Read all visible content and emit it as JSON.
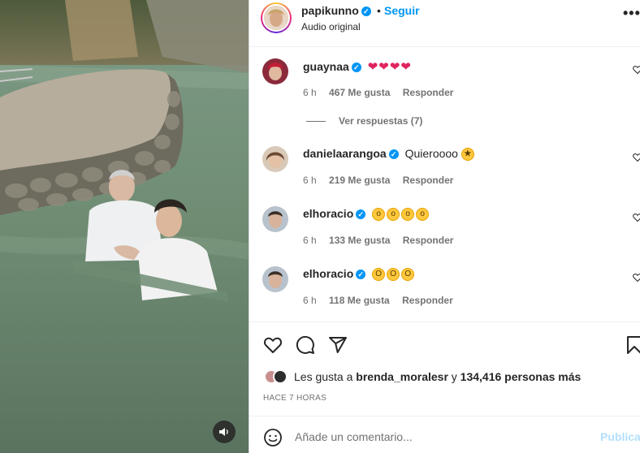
{
  "header": {
    "username": "papikunno",
    "separator": "•",
    "follow_label": "Seguir",
    "audio_label": "Audio original",
    "more_label": "•••"
  },
  "comments": [
    {
      "username": "guaynaa",
      "text": "❤❤❤❤",
      "time": "6 h",
      "likes": "467 Me gusta",
      "reply": "Responder",
      "avatar_color": "#8a2a3a"
    },
    {
      "username": "danielaarangoa",
      "text": "Quieroooo",
      "time": "6 h",
      "likes": "219 Me gusta",
      "reply": "Responder",
      "avatar_color": "#b08a66"
    },
    {
      "username": "elhoracio",
      "text": "",
      "time": "6 h",
      "likes": "133 Me gusta",
      "reply": "Responder",
      "avatar_color": "#9aa3ad"
    },
    {
      "username": "elhoracio",
      "text": "",
      "time": "6 h",
      "likes": "118 Me gusta",
      "reply": "Responder",
      "avatar_color": "#9aa3ad"
    }
  ],
  "view_replies": "Ver respuestas (7)",
  "likes": {
    "prefix": "Les gusta a",
    "user": "brenda_moralesr",
    "connector": "y",
    "count": "134,416 personas más"
  },
  "time_ago": "HACE 7 HORAS",
  "add_comment": {
    "placeholder": "Añade un comentario...",
    "publish_label": "Publicar"
  },
  "colors": {
    "accent": "#0095f6",
    "publish_disabled": "#b2dffc",
    "heart": "#e0245e",
    "meta": "#737373"
  }
}
